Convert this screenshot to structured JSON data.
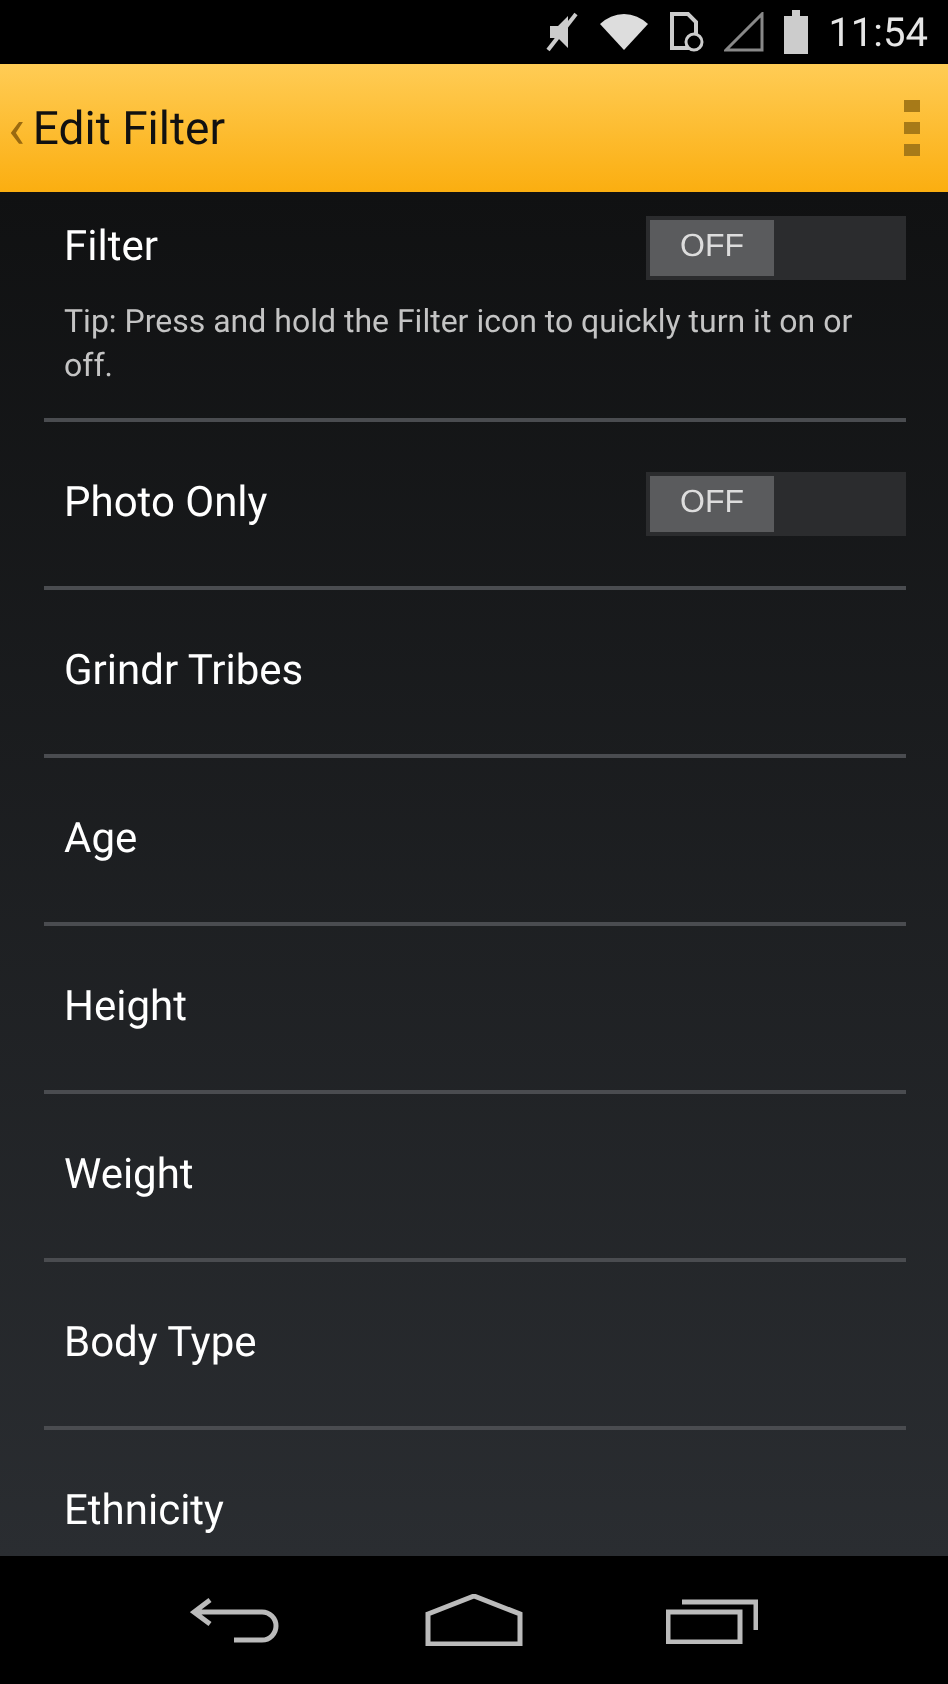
{
  "status_bar": {
    "time": "11:54"
  },
  "action_bar": {
    "back": "‹",
    "title": "Edit Filter"
  },
  "settings": [
    {
      "kind": "toggle",
      "label": "Filter",
      "on": false,
      "state_text": "OFF",
      "tip": "Tip: Press and hold the Filter icon to quickly turn it on or off."
    },
    {
      "kind": "toggle",
      "label": "Photo Only",
      "on": false,
      "state_text": "OFF"
    },
    {
      "kind": "link",
      "label": "Grindr Tribes"
    },
    {
      "kind": "link",
      "label": "Age"
    },
    {
      "kind": "link",
      "label": "Height"
    },
    {
      "kind": "link",
      "label": "Weight"
    },
    {
      "kind": "link",
      "label": "Body Type"
    },
    {
      "kind": "link",
      "label": "Ethnicity"
    }
  ]
}
